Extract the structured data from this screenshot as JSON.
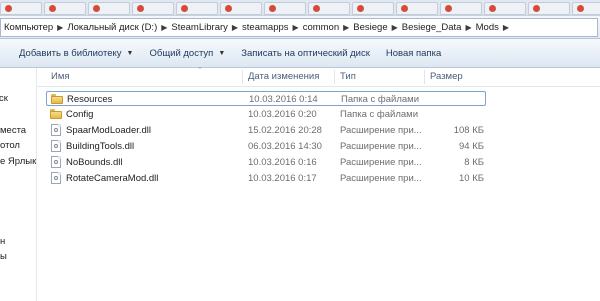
{
  "address_bar": {
    "crumbs": [
      "Компьютер",
      "Локальный диск (D:)",
      "SteamLibrary",
      "steamapps",
      "common",
      "Besiege",
      "Besiege_Data",
      "Mods"
    ]
  },
  "toolbar": {
    "add_to_library": "Добавить в библиотеку",
    "share": "Общий доступ",
    "burn": "Записать на оптический диск",
    "new_folder": "Новая папка"
  },
  "nav_pane": {
    "items": [
      "ск",
      "места",
      "отол",
      "е Ярлык",
      "н",
      "ы"
    ]
  },
  "columns": {
    "name": "Имя",
    "date": "Дата изменения",
    "type": "Тип",
    "size": "Размер"
  },
  "files": [
    {
      "name": "Resources",
      "date": "10.03.2016 0:14",
      "type": "Папка с файлами",
      "size": "",
      "icon": "folder-icon"
    },
    {
      "name": "Config",
      "date": "10.03.2016 0:20",
      "type": "Папка с файлами",
      "size": "",
      "icon": "folder-icon"
    },
    {
      "name": "SpaarModLoader.dll",
      "date": "15.02.2016 20:28",
      "type": "Расширение при...",
      "size": "108 КБ",
      "icon": "dll-file-icon"
    },
    {
      "name": "BuildingTools.dll",
      "date": "06.03.2016 14:30",
      "type": "Расширение при...",
      "size": "94 КБ",
      "icon": "dll-file-icon"
    },
    {
      "name": "NoBounds.dll",
      "date": "10.03.2016 0:16",
      "type": "Расширение при...",
      "size": "8 КБ",
      "icon": "dll-file-icon"
    },
    {
      "name": "RotateCameraMod.dll",
      "date": "10.03.2016 0:17",
      "type": "Расширение при...",
      "size": "10 КБ",
      "icon": "dll-file-icon"
    }
  ],
  "colors": {
    "selection_border": "#7da2ce",
    "toolbar_text": "#1e395b",
    "folder": "#e6b94b"
  }
}
